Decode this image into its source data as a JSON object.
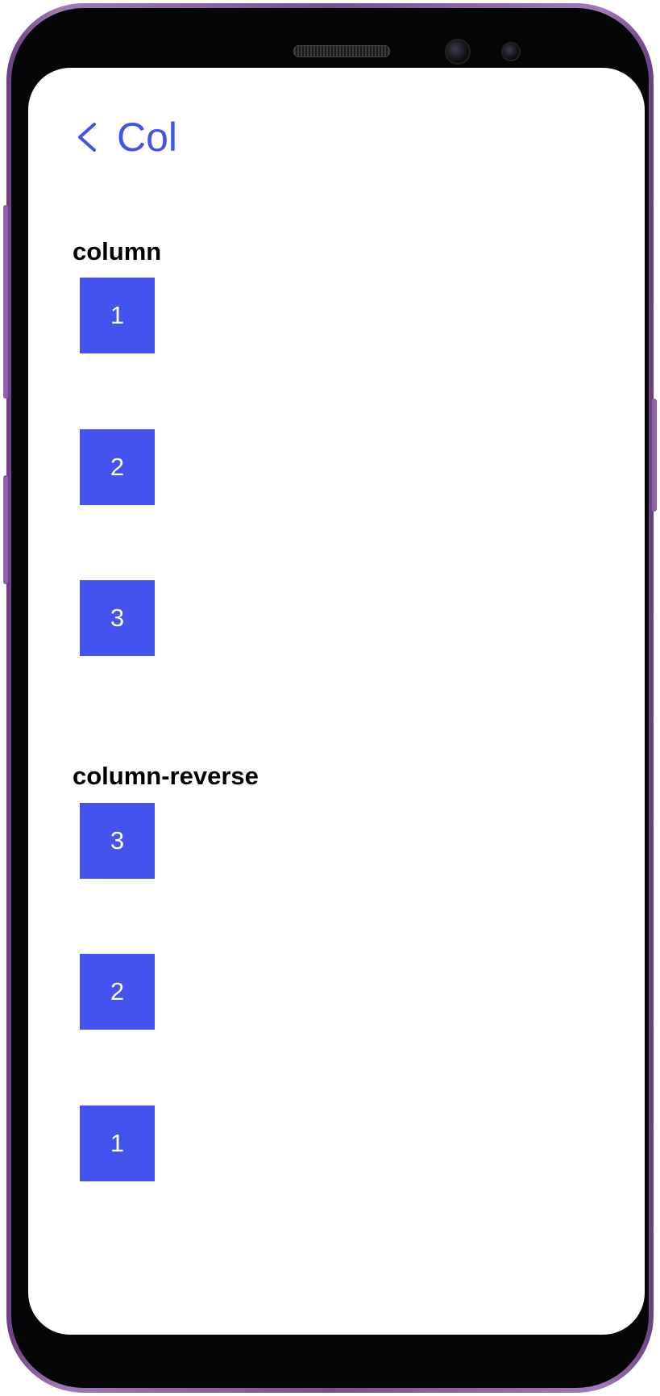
{
  "header": {
    "title": "Col"
  },
  "sections": [
    {
      "title": "column",
      "items": [
        "1",
        "2",
        "3"
      ]
    },
    {
      "title": "column-reverse",
      "items": [
        "3",
        "2",
        "1"
      ]
    }
  ],
  "colors": {
    "accent": "#4452ee",
    "frame": "#7a4e97"
  },
  "icons": {
    "back": "chevron-left-icon"
  }
}
